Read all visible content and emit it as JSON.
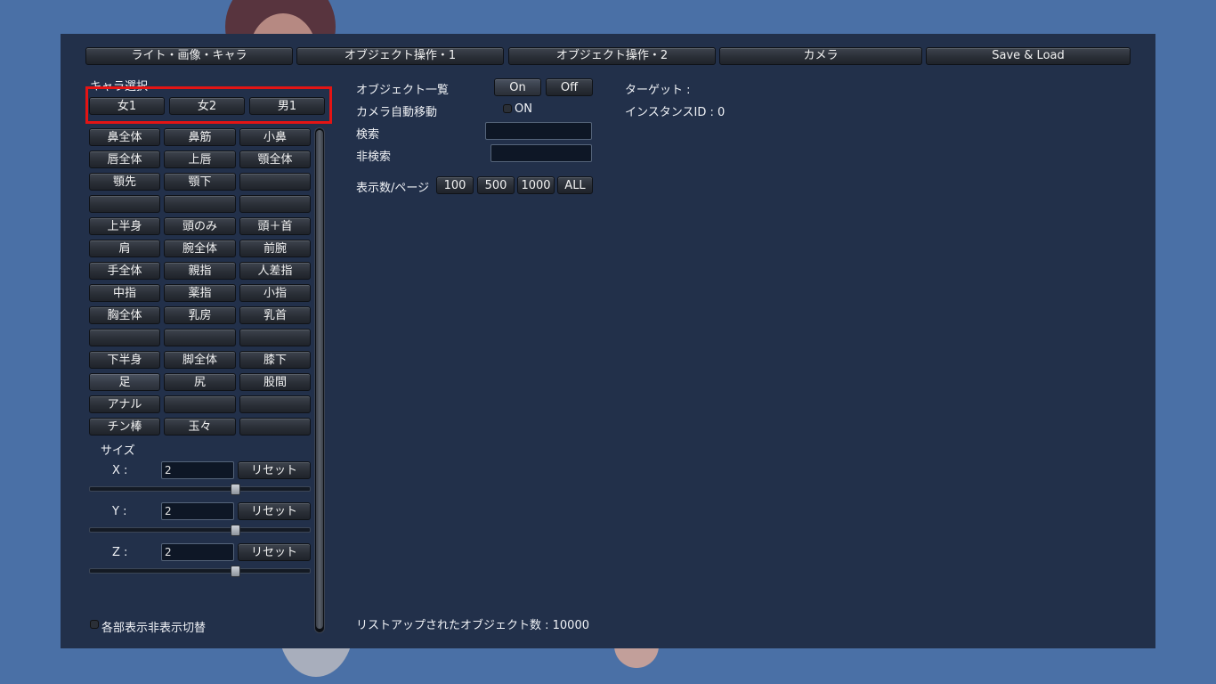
{
  "tabs": [
    "ライト・画像・キャラ",
    "オブジェクト操作・1",
    "オブジェクト操作・2",
    "カメラ",
    "Save & Load"
  ],
  "chara_select": {
    "label": "キャラ選択",
    "buttons": [
      "女1",
      "女2",
      "男1"
    ]
  },
  "parts": [
    [
      "鼻全体",
      "鼻筋",
      "小鼻"
    ],
    [
      "唇全体",
      "上唇",
      "顎全体"
    ],
    [
      "顎先",
      "顎下",
      ""
    ],
    [
      "",
      "",
      ""
    ],
    [
      "上半身",
      "頭のみ",
      "頭＋首"
    ],
    [
      "肩",
      "腕全体",
      "前腕"
    ],
    [
      "手全体",
      "親指",
      "人差指"
    ],
    [
      "中指",
      "薬指",
      "小指"
    ],
    [
      "胸全体",
      "乳房",
      "乳首"
    ],
    [
      "",
      "",
      ""
    ],
    [
      "下半身",
      "脚全体",
      "膝下"
    ],
    [
      "足",
      "尻",
      "股間"
    ],
    [
      "アナル",
      "",
      ""
    ],
    [
      "チン棒",
      "玉々",
      ""
    ]
  ],
  "size": {
    "label": "サイズ",
    "axes": [
      {
        "label": "X :",
        "value": "2",
        "reset": "リセット",
        "slider": 0.5
      },
      {
        "label": "Y :",
        "value": "2",
        "reset": "リセット",
        "slider": 0.5
      },
      {
        "label": "Z :",
        "value": "2",
        "reset": "リセット",
        "slider": 0.5
      }
    ]
  },
  "toggle_parts_label": "各部表示非表示切替",
  "objects": {
    "list_label": "オブジェクト一覧",
    "on_label": "On",
    "off_label": "Off",
    "target_label": "ターゲット :",
    "camera_auto_label": "カメラ自動移動",
    "camera_auto_value": "ON",
    "instance_label": "インスタンスID : 0",
    "search_label": "検索",
    "search_value": "",
    "exclude_label": "非検索",
    "exclude_value": "",
    "per_page_label": "表示数/ページ",
    "per_page_options": [
      "100",
      "500",
      "1000",
      "ALL"
    ],
    "listed_count": "リストアップされたオブジェクト数 : 10000"
  }
}
